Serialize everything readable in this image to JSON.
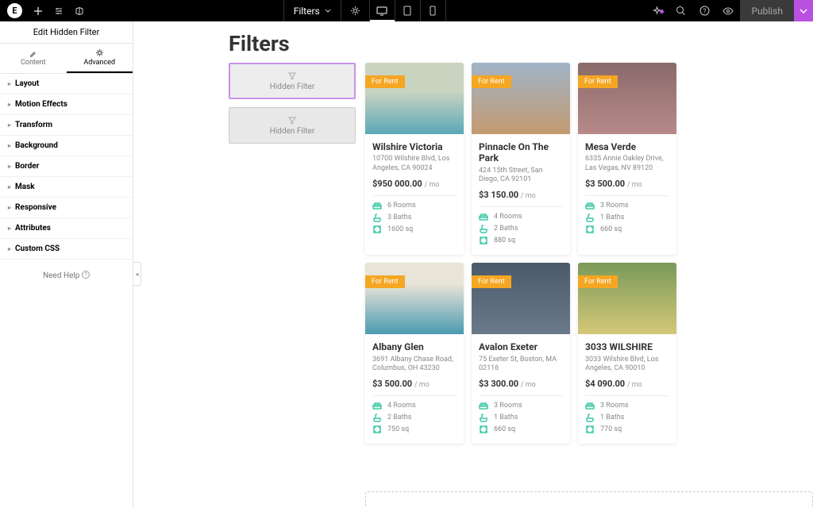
{
  "topbar": {
    "filters_label": "Filters",
    "publish_label": "Publish"
  },
  "sidebar": {
    "panel_title": "Edit Hidden Filter",
    "tab_content": "Content",
    "tab_advanced": "Advanced",
    "sections": [
      "Layout",
      "Motion Effects",
      "Transform",
      "Background",
      "Border",
      "Mask",
      "Responsive",
      "Attributes",
      "Custom CSS"
    ],
    "need_help": "Need Help"
  },
  "canvas": {
    "page_title": "Filters",
    "hidden_filter_label": "Hidden Filter"
  },
  "listings": [
    {
      "title": "Wilshire Victoria",
      "addr": "10700 Wilshire Blvd, Los Angeles, CA 90024",
      "price": "$950 000.00",
      "per": "/ mo",
      "rooms": "6 Rooms",
      "baths": "3 Baths",
      "sq": "1600 sq",
      "img": "img1"
    },
    {
      "title": "Pinnacle On The Park",
      "addr": "424 15th Street, San Diego, CA 92101",
      "price": "$3 150.00",
      "per": "/ mo",
      "rooms": "4 Rooms",
      "baths": "2 Baths",
      "sq": "880 sq",
      "img": "img2"
    },
    {
      "title": "Mesa Verde",
      "addr": "6335 Annie Oakley Drive, Las Vegas, NV 89120",
      "price": "$3 500.00",
      "per": "/ mo",
      "rooms": "3 Rooms",
      "baths": "1 Baths",
      "sq": "660 sq",
      "img": "img3"
    },
    {
      "title": "Albany Glen",
      "addr": "3691 Albany Chase Road, Columbus, OH 43230",
      "price": "$3 500.00",
      "per": "/ mo",
      "rooms": "4 Rooms",
      "baths": "2 Baths",
      "sq": "750 sq",
      "img": "img4"
    },
    {
      "title": "Avalon Exeter",
      "addr": "75 Exeter St, Boston, MA 02116",
      "price": "$3 300.00",
      "per": "/ mo",
      "rooms": "3 Rooms",
      "baths": "1 Baths",
      "sq": "660 sq",
      "img": "img5"
    },
    {
      "title": "3033 WILSHIRE",
      "addr": "3033 Wilshire Blvd, Los Angeles, CA 90010",
      "price": "$4 090.00",
      "per": "/ mo",
      "rooms": "3 Rooms",
      "baths": "1 Baths",
      "sq": "770 sq",
      "img": "img6"
    }
  ],
  "badge_label": "For Rent"
}
